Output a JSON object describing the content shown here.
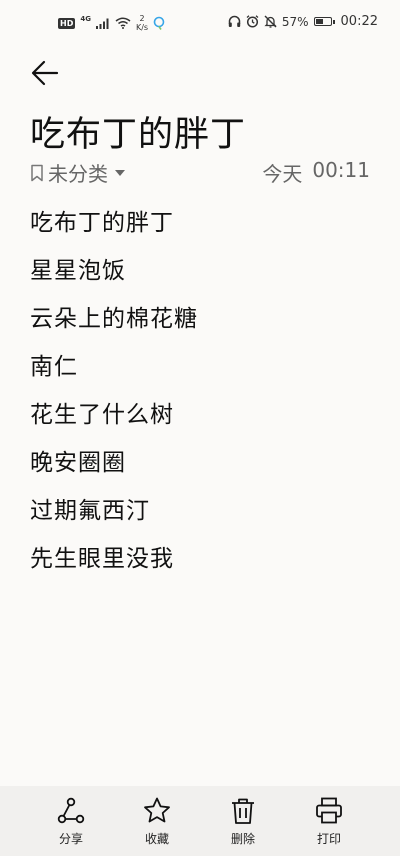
{
  "status_bar": {
    "hd": "HD",
    "network": "4G",
    "speed_value": "2",
    "speed_unit": "K/s",
    "battery_percent": "57%",
    "battery_level": 0.57,
    "time": "00:22"
  },
  "note": {
    "title": "吃布丁的胖丁",
    "category": "未分类",
    "date_label": "今天",
    "time": "00:11",
    "lines": [
      "吃布丁的胖丁",
      "星星泡饭",
      "云朵上的棉花糖",
      "南仁",
      "花生了什么树",
      "晚安圈圈",
      "过期氟西汀",
      "先生眼里没我"
    ]
  },
  "toolbar": {
    "share_label": "分享",
    "favorite_label": "收藏",
    "delete_label": "删除",
    "print_label": "打印"
  }
}
